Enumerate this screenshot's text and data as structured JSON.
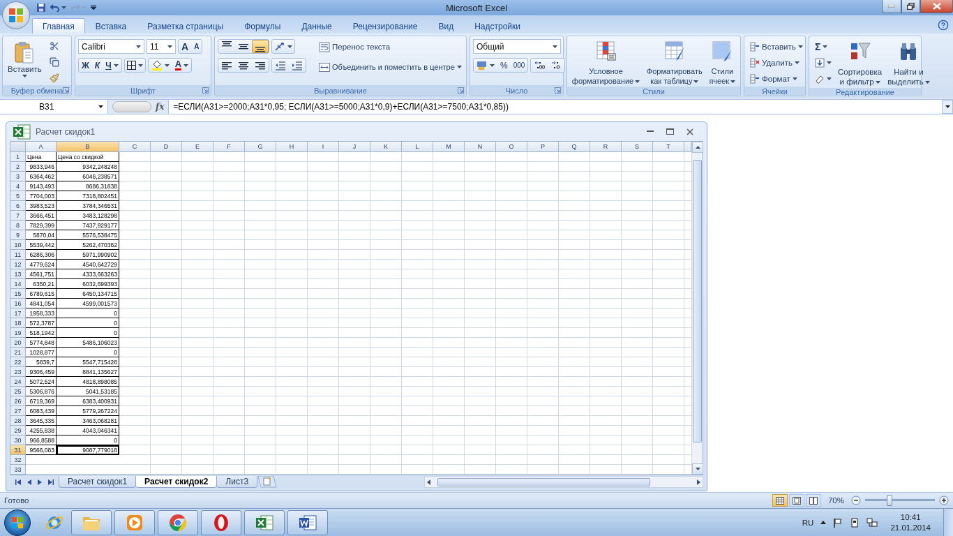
{
  "title_bar": {
    "title": "Microsoft Excel"
  },
  "tabs": [
    {
      "label": "Главная",
      "selected": true
    },
    {
      "label": "Вставка",
      "selected": false
    },
    {
      "label": "Разметка страницы",
      "selected": false
    },
    {
      "label": "Формулы",
      "selected": false
    },
    {
      "label": "Данные",
      "selected": false
    },
    {
      "label": "Рецензирование",
      "selected": false
    },
    {
      "label": "Вид",
      "selected": false
    },
    {
      "label": "Надстройки",
      "selected": false
    }
  ],
  "ribbon": {
    "clipboard": {
      "label": "Буфер обмена",
      "paste": "Вставить"
    },
    "font": {
      "label": "Шрифт",
      "font_name": "Calibri",
      "font_size": "11",
      "grow": "A",
      "shrink": "A",
      "bold": "Ж",
      "italic": "К",
      "underline": "Ч",
      "font_color": "A"
    },
    "alignment": {
      "label": "Выравнивание",
      "vertical": [
        {
          "selected": false
        },
        {
          "selected": false
        },
        {
          "selected": true
        }
      ],
      "wrap_text": "Перенос текста",
      "merge": "Объединить и поместить в центре"
    },
    "number": {
      "label": "Число",
      "format": "Общий",
      "percent": "%",
      "thousands": "000"
    },
    "styles": {
      "label": "Стили",
      "buttons": [
        {
          "line1": "Условное",
          "line2": "форматирование"
        },
        {
          "line1": "Форматировать",
          "line2": "как таблицу"
        },
        {
          "line1": "Стили",
          "line2": "ячеек"
        }
      ]
    },
    "cells": {
      "label": "Ячейки",
      "buttons": [
        "Вставить",
        "Удалить",
        "Формат"
      ]
    },
    "editing": {
      "label": "Редактирование",
      "sum": "Σ",
      "buttons": [
        {
          "line1": "Сортировка",
          "line2": "и фильтр"
        },
        {
          "line1": "Найти и",
          "line2": "выделить"
        }
      ]
    }
  },
  "formula_bar": {
    "name_box": "B31",
    "fx": "fx",
    "formula": "=ЕСЛИ(A31>=2000;A31*0,95; ЕСЛИ(A31>=5000;A31*0,9)+ЕСЛИ(A31>=7500;A31*0,85))"
  },
  "workbook": {
    "title": "Расчет скидок1",
    "columns": [
      {
        "label": "A",
        "selected": false
      },
      {
        "label": "B",
        "selected": true
      },
      {
        "label": "C",
        "selected": false
      },
      {
        "label": "D",
        "selected": false
      },
      {
        "label": "E",
        "selected": false
      },
      {
        "label": "F",
        "selected": false
      },
      {
        "label": "G",
        "selected": false
      },
      {
        "label": "H",
        "selected": false
      },
      {
        "label": "I",
        "selected": false
      },
      {
        "label": "J",
        "selected": false
      },
      {
        "label": "K",
        "selected": false
      },
      {
        "label": "L",
        "selected": false
      },
      {
        "label": "M",
        "selected": false
      },
      {
        "label": "N",
        "selected": false
      },
      {
        "label": "O",
        "selected": false
      },
      {
        "label": "P",
        "selected": false
      },
      {
        "label": "Q",
        "selected": false
      },
      {
        "label": "R",
        "selected": false
      },
      {
        "label": "S",
        "selected": false
      },
      {
        "label": "T",
        "selected": false
      }
    ],
    "header_row": {
      "number": "1",
      "a": "Цена",
      "b": "Цена со скидкой"
    },
    "rows": [
      {
        "number": "2",
        "a": "9833,946",
        "b": "9342,248248",
        "selected": false
      },
      {
        "number": "3",
        "a": "6364,462",
        "b": "6046,238571",
        "selected": false
      },
      {
        "number": "4",
        "a": "9143,493",
        "b": "8686,31838",
        "selected": false
      },
      {
        "number": "5",
        "a": "7704,003",
        "b": "7318,802451",
        "selected": false
      },
      {
        "number": "6",
        "a": "3983,523",
        "b": "3784,346531",
        "selected": false
      },
      {
        "number": "7",
        "a": "3666,451",
        "b": "3483,128298",
        "selected": false
      },
      {
        "number": "8",
        "a": "7829,399",
        "b": "7437,929177",
        "selected": false
      },
      {
        "number": "9",
        "a": "5870,04",
        "b": "5576,538475",
        "selected": false
      },
      {
        "number": "10",
        "a": "5539,442",
        "b": "5262,470362",
        "selected": false
      },
      {
        "number": "11",
        "a": "6286,306",
        "b": "5971,990902",
        "selected": false
      },
      {
        "number": "12",
        "a": "4779,624",
        "b": "4540,642729",
        "selected": false
      },
      {
        "number": "13",
        "a": "4561,751",
        "b": "4333,663263",
        "selected": false
      },
      {
        "number": "14",
        "a": "6350,21",
        "b": "6032,699393",
        "selected": false
      },
      {
        "number": "15",
        "a": "6789,615",
        "b": "6450,134715",
        "selected": false
      },
      {
        "number": "16",
        "a": "4841,054",
        "b": "4599,001573",
        "selected": false
      },
      {
        "number": "17",
        "a": "1958,333",
        "b": "0",
        "selected": false
      },
      {
        "number": "18",
        "a": "572,3787",
        "b": "0",
        "selected": false
      },
      {
        "number": "19",
        "a": "518,1942",
        "b": "0",
        "selected": false
      },
      {
        "number": "20",
        "a": "5774,848",
        "b": "5486,106023",
        "selected": false
      },
      {
        "number": "21",
        "a": "1028,877",
        "b": "0",
        "selected": false
      },
      {
        "number": "22",
        "a": "5839,7",
        "b": "5547,715428",
        "selected": false
      },
      {
        "number": "23",
        "a": "9306,459",
        "b": "8841,135627",
        "selected": false
      },
      {
        "number": "24",
        "a": "5072,524",
        "b": "4818,898085",
        "selected": false
      },
      {
        "number": "25",
        "a": "5306,876",
        "b": "5041,53185",
        "selected": false
      },
      {
        "number": "26",
        "a": "6719,369",
        "b": "6383,400931",
        "selected": false
      },
      {
        "number": "27",
        "a": "6083,439",
        "b": "5779,267224",
        "selected": false
      },
      {
        "number": "28",
        "a": "3645,335",
        "b": "3463,068281",
        "selected": false
      },
      {
        "number": "29",
        "a": "4255,838",
        "b": "4043,046341",
        "selected": false
      },
      {
        "number": "30",
        "a": "966,8588",
        "b": "0",
        "selected": false
      },
      {
        "number": "31",
        "a": "9566,083",
        "b": "9087,779018",
        "selected": true
      },
      {
        "number": "32",
        "selected": false
      },
      {
        "number": "33",
        "selected": false
      }
    ],
    "sheet_tabs": [
      {
        "label": "Расчет скидок1",
        "selected": false
      },
      {
        "label": "Расчет скидок2",
        "selected": true
      },
      {
        "label": "Лист3",
        "selected": false
      }
    ]
  },
  "status_bar": {
    "status": "Готово",
    "views": [
      {
        "selected": true
      },
      {
        "selected": false
      },
      {
        "selected": false
      }
    ],
    "zoom": "70%",
    "zoom_slider": {
      "level": 0.35
    }
  },
  "taskbar": {
    "apps": [
      {
        "kind": "browser-e",
        "running": false
      },
      {
        "kind": "folder",
        "running": true
      },
      {
        "kind": "player",
        "running": true
      },
      {
        "kind": "chrome",
        "running": true
      },
      {
        "kind": "opera",
        "running": true
      },
      {
        "kind": "sheet",
        "running": true
      },
      {
        "kind": "doc",
        "running": true
      }
    ],
    "language": "RU",
    "time": "10:41",
    "date": "21.01.2014"
  }
}
